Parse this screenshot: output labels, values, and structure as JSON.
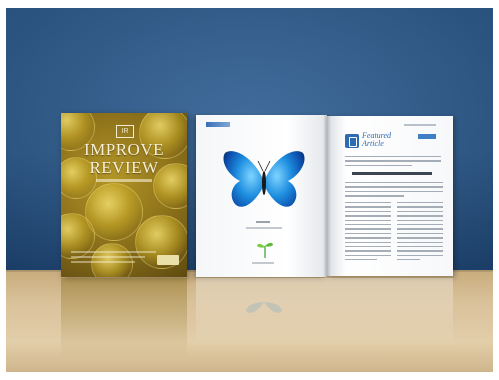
{
  "scene": {
    "description_colors": {
      "wall": "#2c5c90",
      "shelf": "#d9c19a",
      "cover": "#8a6f1a",
      "accent_blue": "#2d6bb3"
    }
  },
  "left_magazine": {
    "logo_mark": "IR",
    "title_line1": "IMPROVE",
    "title_line2": "REVIEW"
  },
  "open_magazine": {
    "right_page": {
      "brand_line1": "Featured",
      "brand_line2": "Article"
    }
  }
}
